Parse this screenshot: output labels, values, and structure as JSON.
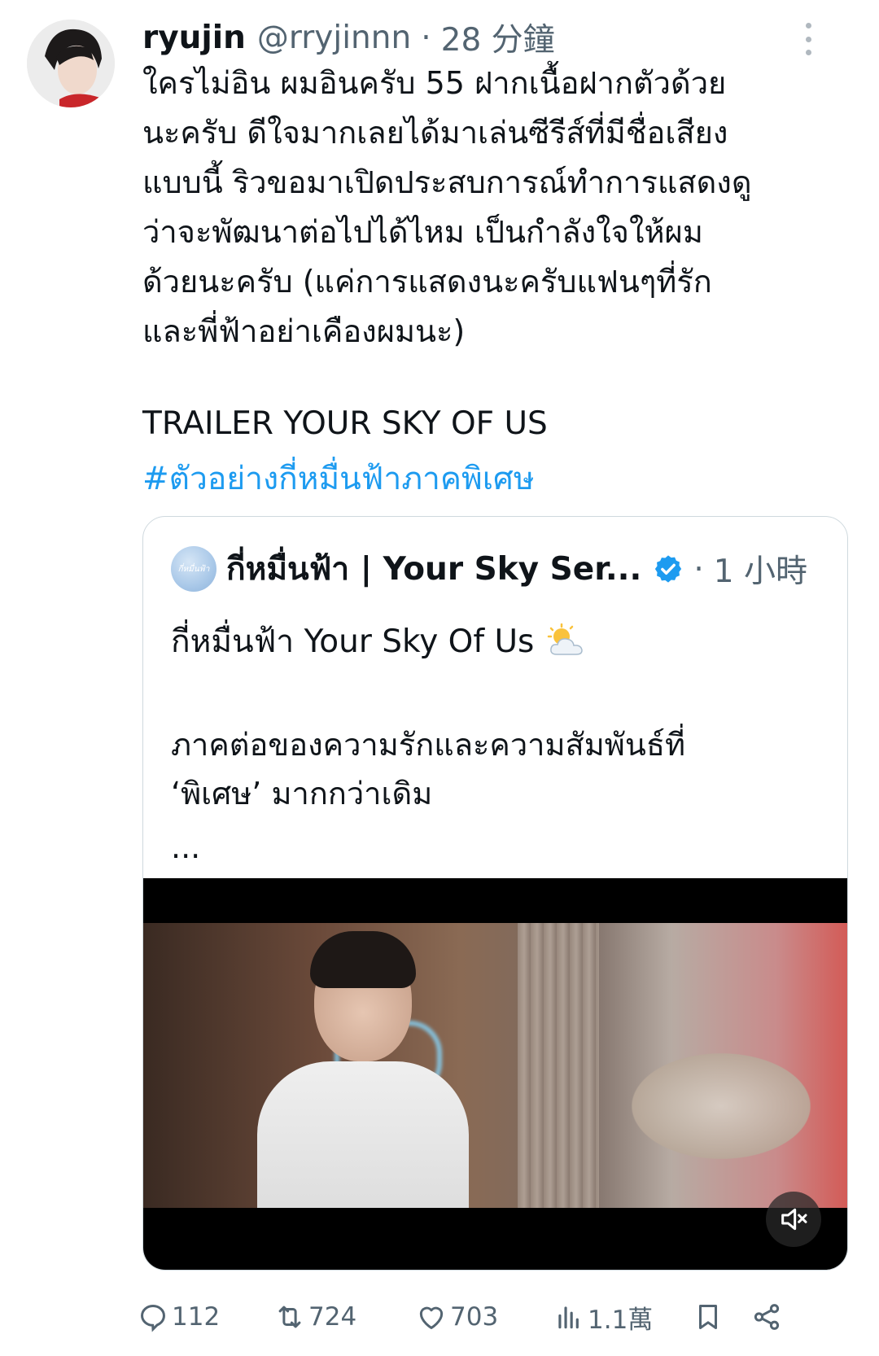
{
  "tweet": {
    "author_name": "ryujin",
    "author_handle": "@rryjinnn",
    "separator": "·",
    "time": "28 分鐘",
    "text_lines": [
      "ใครไม่อิน ผมอินครับ 55 ฝากเนื้อฝากตัวด้วย",
      "นะครับ ดีใจมากเลยได้มาเล่นซีรีส์ที่มีชื่อเสียง",
      "แบบนี้ ริวขอมาเปิดประสบการณ์ทำการแสดงดู",
      "ว่าจะพัฒนาต่อไปได้ไหม เป็นกำลังใจให้ผม",
      "ด้วยนะครับ (แค่การแสดงนะครับแฟนๆที่รัก",
      "และพี่ฟ้าอย่าเคืองผมนะ)"
    ],
    "trailer_line": "TRAILER YOUR SKY OF US",
    "hashtag": "#ตัวอย่างกี่หมื่นฟ้าภาคพิเศษ"
  },
  "quote": {
    "avatar_text": "กี่หมื่นฟ้า",
    "author_name": "กี่หมื่นฟ้า | Your Sky Ser...",
    "separator": "·",
    "time": "1 小時",
    "line1": "กี่หมื่นฟ้า Your Sky Of Us",
    "body_lines": [
      "ภาคต่อของความรักและความสัมพันธ์ที่",
      "‘พิเศษ’ มากกว่าเดิม"
    ],
    "ellipsis": "..."
  },
  "actions": {
    "replies": "112",
    "retweets": "724",
    "likes": "703",
    "views": "1.1萬"
  },
  "colors": {
    "link": "#1d9bf0",
    "muted": "#536471",
    "verified": "#1d9bf0"
  }
}
